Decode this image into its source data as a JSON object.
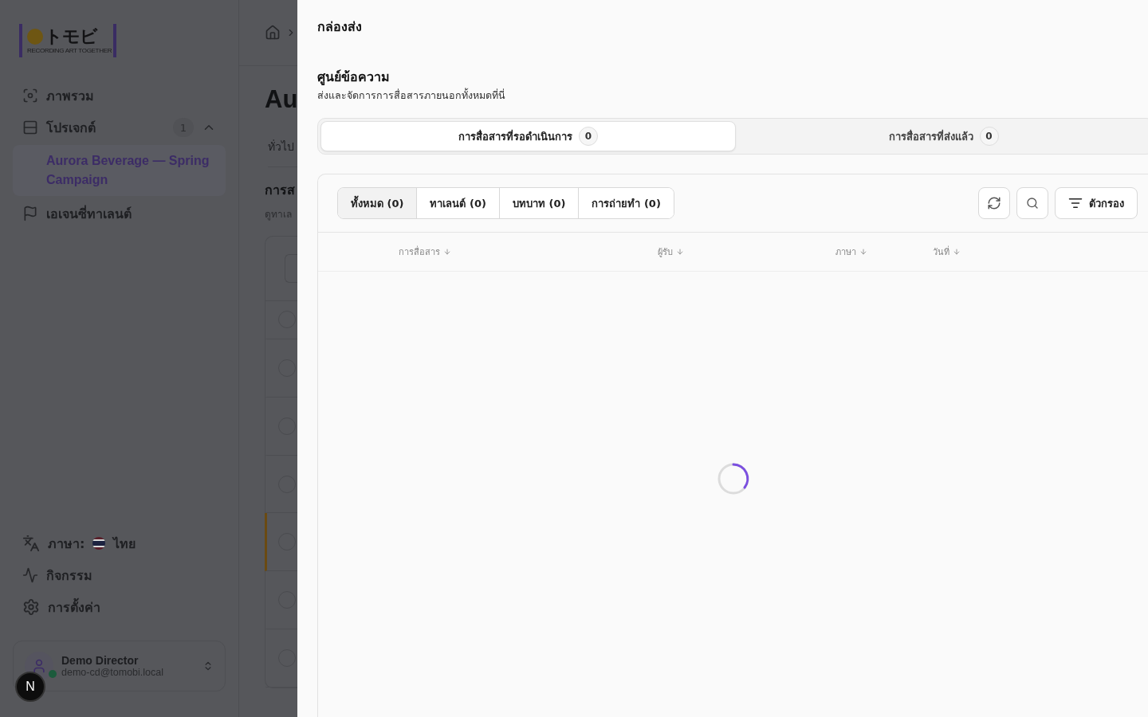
{
  "sidebar": {
    "logo": {
      "mark": "トモビ",
      "tagline": "RECORDING ART TOGETHER"
    },
    "nav": [
      {
        "kind": "overview",
        "label": "ภาพรวม"
      },
      {
        "kind": "projects",
        "label": "โปรเจกต์",
        "count": "1",
        "expanded": true,
        "children": [
          {
            "label": "Aurora Beverage — Spring Campaign",
            "selected": true
          }
        ]
      },
      {
        "kind": "agencies",
        "label": "เอเจนซี่ทาเลนต์"
      }
    ],
    "footer_nav": [
      {
        "kind": "language",
        "label": "ภาษา:",
        "value": "ไทย"
      },
      {
        "kind": "activity",
        "label": "กิจกรรม"
      },
      {
        "kind": "settings",
        "label": "การตั้งค่า"
      }
    ],
    "user": {
      "name": "Demo Director",
      "email": "demo-cd@tomobi.local",
      "online": true
    },
    "dev_badge": "N"
  },
  "page": {
    "title": "Au",
    "tab": "ทั่วไป",
    "section_title": "การส",
    "section_subtitle": "ดูทาเล",
    "all_checked": false,
    "rows": [
      {
        "highlighted": false,
        "checked": false
      },
      {
        "highlighted": false,
        "checked": false
      },
      {
        "highlighted": false,
        "checked": false
      },
      {
        "highlighted": true,
        "checked": false
      },
      {
        "highlighted": false,
        "checked": false
      },
      {
        "highlighted": false,
        "checked": false
      }
    ]
  },
  "drawer": {
    "title": "กล่องส่ง",
    "section_title": "ศูนย์ข้อความ",
    "section_subtitle": "ส่งและจัดการการสื่อสารภายนอกทั้งหมดที่นี่",
    "tabs": [
      {
        "label": "การสื่อสารที่รอดำเนินการ",
        "count": "0",
        "selected": true
      },
      {
        "label": "การสื่อสารที่ส่งแล้ว",
        "count": "0",
        "selected": false
      }
    ],
    "filters": [
      {
        "label": "ทั้งหมด (0)",
        "selected": true
      },
      {
        "label": "ทาเลนต์ (0)",
        "selected": false
      },
      {
        "label": "บทบาท (0)",
        "selected": false
      },
      {
        "label": "การถ่ายทำ (0)",
        "selected": false
      }
    ],
    "filter_button": "ตัวกรอง",
    "columns": [
      "การสื่อสาร",
      "ผู้รับ",
      "ภาษา",
      "วันที่"
    ],
    "loading": true
  }
}
